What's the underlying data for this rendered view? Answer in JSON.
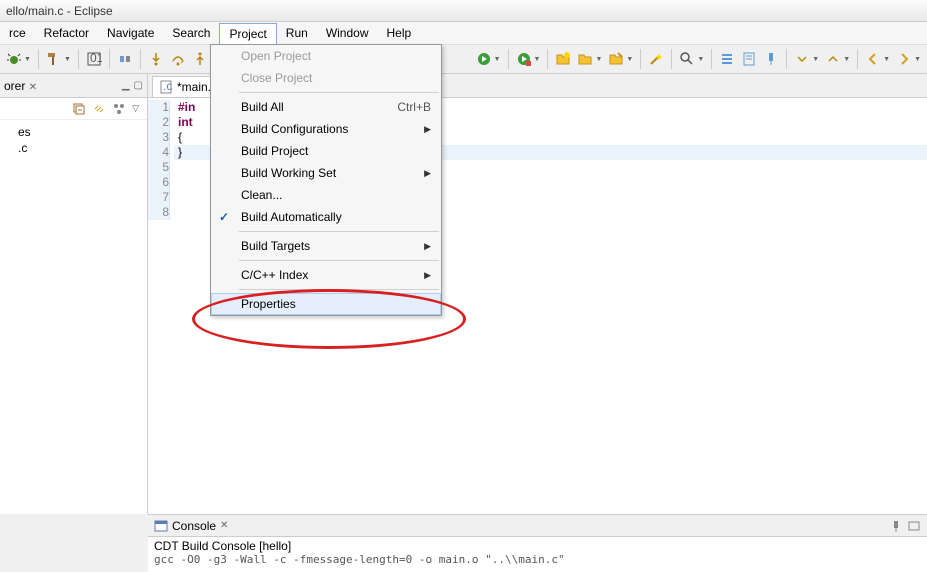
{
  "title": "ello/main.c - Eclipse",
  "menu": {
    "items": [
      "rce",
      "Refactor",
      "Navigate",
      "Search",
      "Project",
      "Run",
      "Window",
      "Help"
    ],
    "active_index": 4
  },
  "dropdown": {
    "open_project": "Open Project",
    "close_project": "Close Project",
    "build_all": "Build All",
    "build_all_accel": "Ctrl+B",
    "build_configurations": "Build Configurations",
    "build_project": "Build Project",
    "build_working_set": "Build Working Set",
    "clean": "Clean...",
    "build_automatically": "Build Automatically",
    "build_targets": "Build Targets",
    "cc_index": "C/C++ Index",
    "properties": "Properties"
  },
  "sidebar": {
    "tab_label": "orer",
    "items": [
      "es",
      ".c"
    ]
  },
  "editor": {
    "tab_label": "*main.",
    "lines": [
      {
        "num": "1",
        "pre": "#in",
        "rest": ""
      },
      {
        "num": "2",
        "pre": "",
        "rest": ""
      },
      {
        "num": "3",
        "pre": "int",
        "rest": "",
        "marker": true
      },
      {
        "num": "4",
        "pre": "",
        "rest": "{"
      },
      {
        "num": "5",
        "pre": "",
        "rest": ""
      },
      {
        "num": "6",
        "pre": "",
        "rest": ""
      },
      {
        "num": "7",
        "pre": "",
        "rest": ""
      },
      {
        "num": "8",
        "pre": "",
        "rest": "}",
        "highlight": true
      }
    ]
  },
  "console": {
    "tab_label": "Console",
    "title": "CDT Build Console [hello]",
    "cmd": "gcc -O0 -g3 -Wall -c -fmessage-length=0 -o main.o \"..\\\\main.c\""
  }
}
